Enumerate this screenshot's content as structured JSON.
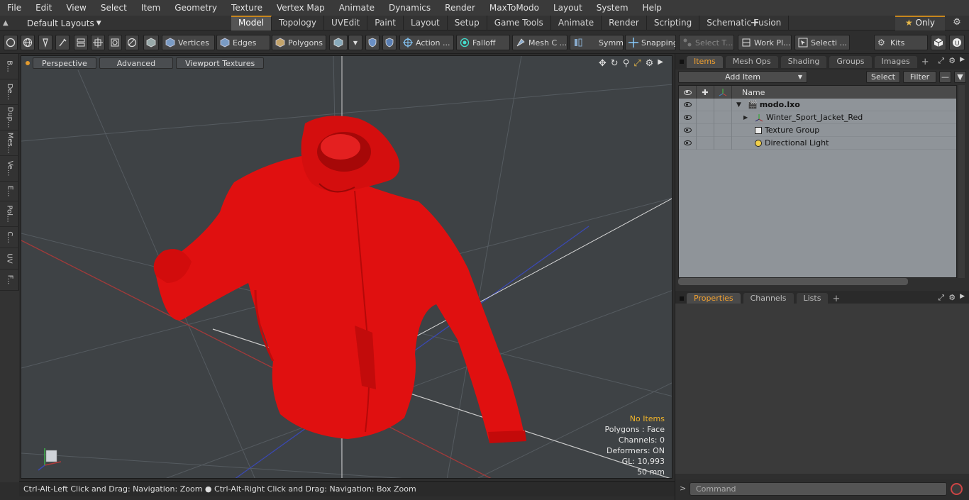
{
  "menu": [
    "File",
    "Edit",
    "View",
    "Select",
    "Item",
    "Geometry",
    "Texture",
    "Vertex Map",
    "Animate",
    "Dynamics",
    "Render",
    "MaxToModo",
    "Layout",
    "System",
    "Help"
  ],
  "layout_selector": "Default Layouts",
  "mode_tabs": [
    "Model",
    "Topology",
    "UVEdit",
    "Paint",
    "Layout",
    "Setup",
    "Game Tools",
    "Animate",
    "Render",
    "Scripting",
    "Schematic Fusion"
  ],
  "active_mode": "Model",
  "only_label": "Only",
  "toolbar": {
    "vertices": "Vertices",
    "edges": "Edges",
    "polygons": "Polygons",
    "action": "Action ...",
    "falloff": "Falloff",
    "mesh": "Mesh C ...",
    "symm": "Symm ...",
    "snapping": "Snapping",
    "select_t": "Select T...",
    "work_pl": "Work Pl...",
    "selecti": "Selecti ...",
    "kits": "Kits"
  },
  "left_tabs": [
    "B...",
    "De...",
    "Dup...",
    "Mes...",
    "Ve...",
    "E...",
    "Pol...",
    "C...",
    "UV",
    "F..."
  ],
  "viewport": {
    "tabs": [
      "Perspective",
      "Advanced",
      "Viewport Textures"
    ],
    "stats": {
      "no_items": "No Items",
      "polygons": "Polygons : Face",
      "channels": "Channels: 0",
      "deformers": "Deformers: ON",
      "gl": "GL: 10,993",
      "focal": "50 mm"
    },
    "jacket_color": "#e01010"
  },
  "statusbar": {
    "left": "Ctrl-Alt-Left Click and Drag: Navigation: Zoom",
    "right": "Ctrl-Alt-Right Click and Drag: Navigation: Box Zoom"
  },
  "items_panel": {
    "tabs": [
      "Items",
      "Mesh Ops",
      "Shading",
      "Groups",
      "Images"
    ],
    "active_tab": "Items",
    "add_item": "Add Item",
    "select": "Select",
    "filter": "Filter",
    "name_header": "Name",
    "items": [
      {
        "name": "modo.lxo",
        "icon": "scene-icon"
      },
      {
        "name": "Winter_Sport_Jacket_Red",
        "icon": "mesh-locator-icon"
      },
      {
        "name": "Texture Group",
        "icon": "texture-group-icon"
      },
      {
        "name": "Directional Light",
        "icon": "light-icon"
      }
    ]
  },
  "properties_panel": {
    "tabs": [
      "Properties",
      "Channels",
      "Lists"
    ],
    "active_tab": "Properties"
  },
  "command": {
    "placeholder": "Command"
  }
}
